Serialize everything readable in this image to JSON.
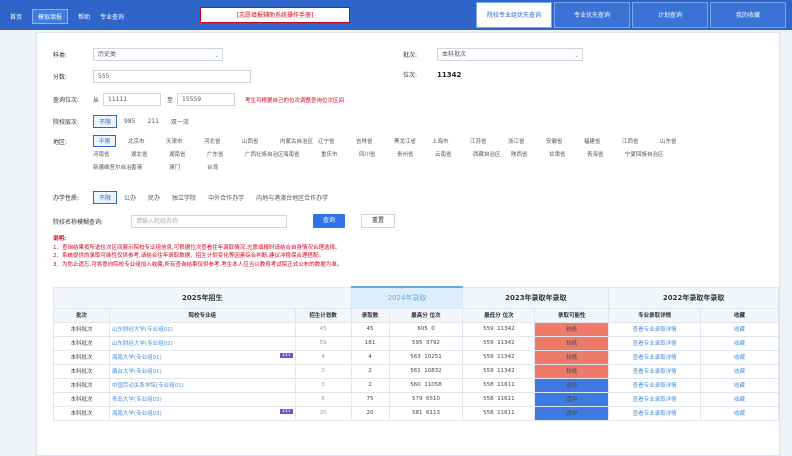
{
  "topbar": {
    "left_items": [
      "首页",
      "模拟填报",
      "帮助",
      "专业查询"
    ],
    "title": "[志愿填报辅助系统操作手册]",
    "tabs": [
      "院校专业组优先查询",
      "专业优先查询",
      "计划查询",
      "我的收藏"
    ],
    "active_tab": 0
  },
  "form": {
    "category_label": "科类:",
    "category_value": "历史类",
    "batch_label": "批次:",
    "batch_value": "本科批次",
    "score_label": "分数:",
    "score_value": "555",
    "rank_label": "位次:",
    "rank_value": "11342",
    "range_label": "查询位次:",
    "range_from_label": "从",
    "range_from": "11111",
    "range_to_label": "至",
    "range_to": "15559",
    "range_hint": "考生可根据自己的位次调整查询位次区间",
    "level_label": "院校层次:",
    "level_options": [
      "不限",
      "985",
      "211",
      "双一流"
    ],
    "area_label": "地区:",
    "area_rows": [
      [
        "不限",
        "北京市",
        "天津市",
        "河北省",
        "山西省",
        "内蒙古自治区",
        "辽宁省",
        "吉林省",
        "黑龙江省",
        "上海市",
        "江苏省",
        "浙江省",
        "安徽省",
        "福建省",
        "江西省",
        "山东省"
      ],
      [
        "河南省",
        "湖北省",
        "湖南省",
        "广东省",
        "广西壮族自治区",
        "海南省",
        "重庆市",
        "四川省",
        "贵州省",
        "云南省",
        "西藏自治区",
        "陕西省",
        "甘肃省",
        "青海省",
        "宁夏回族自治区"
      ],
      [
        "新疆维吾尔自治区",
        "香港",
        "澳门",
        "台湾"
      ]
    ],
    "nature_label": "办学性质:",
    "nature_options": [
      "不限",
      "公办",
      "民办",
      "独立学院",
      "中外合作办学",
      "内地与港澳台地区合作办学"
    ],
    "search_label": "院校名称模糊查询:",
    "search_placeholder": "请输入院校名称",
    "query_button": "查询",
    "reset_button": "重置"
  },
  "notes": {
    "title": "说明:",
    "lines": [
      "1、查询结果按所选位次区间展示院校专业组信息,可根据位次查看往年录取情况,志愿填报时请结合自身情况合理选择。",
      "2、系统提供的录取可能性仅供参考,请结合往年录取数据、招生计划变化等因素综合判断,建议冲稳保合理搭配。",
      "3、为防止遗忘,可将意向院校专业组加入收藏,所有查询结果仅供参考,考生本人应当以教育考试院正式公布的数据为准。"
    ]
  },
  "table": {
    "groups": [
      "2025年招生",
      "2024年录取",
      "2023年录取年录取",
      "2022年录取年录取"
    ],
    "headers": [
      "批次",
      "院校专业组",
      "招生计划数",
      "录取数",
      "最高分 位次",
      "最低分 位次",
      "录取可能性",
      "专业录取详情",
      "收藏"
    ],
    "rows": [
      {
        "batch": "本科批次",
        "school": "山东财经大学(专业组01)",
        "plan": "45",
        "admit": "45",
        "hi_score": "605",
        "hi_rank": "0",
        "lo_score": "559",
        "lo_rank": "11342",
        "prob": "较低",
        "tag": ""
      },
      {
        "batch": "本科批次",
        "school": "山东财经大学(专业组02)",
        "plan": "59",
        "admit": "181",
        "hi_score": "595",
        "hi_rank": "3792",
        "lo_score": "559",
        "lo_rank": "11342",
        "prob": "较低",
        "tag": ""
      },
      {
        "batch": "本科批次",
        "school": "海南大学(专业组01)",
        "plan": "4",
        "admit": "4",
        "hi_score": "563",
        "hi_rank": "10251",
        "lo_score": "559",
        "lo_rank": "11342",
        "prob": "较低",
        "tag": "211"
      },
      {
        "batch": "本科批次",
        "school": "烟台大学(专业组01)",
        "plan": "2",
        "admit": "2",
        "hi_score": "561",
        "hi_rank": "10832",
        "lo_score": "559",
        "lo_rank": "11342",
        "prob": "较低",
        "tag": ""
      },
      {
        "batch": "本科批次",
        "school": "中国劳动关系学院(专业组01)",
        "plan": "3",
        "admit": "2",
        "hi_score": "560",
        "hi_rank": "11058",
        "lo_score": "558",
        "lo_rank": "11611",
        "prob": "适中",
        "tag": ""
      },
      {
        "batch": "本科批次",
        "school": "青岛大学(专业组03)",
        "plan": "5",
        "admit": "75",
        "hi_score": "579",
        "hi_rank": "6510",
        "lo_score": "558",
        "lo_rank": "11611",
        "prob": "适中",
        "tag": ""
      },
      {
        "batch": "本科批次",
        "school": "海南大学(专业组03)",
        "plan": "20",
        "admit": "20",
        "hi_score": "581",
        "hi_rank": "6113",
        "lo_score": "558",
        "lo_rank": "11611",
        "prob": "适中",
        "tag": "211"
      }
    ],
    "detail_label": "查看专业录取详情",
    "fav_label": "收藏"
  },
  "colors": {
    "brand": "#2f64c9",
    "low": "#f07a6a",
    "mid": "#3f7ae0"
  }
}
